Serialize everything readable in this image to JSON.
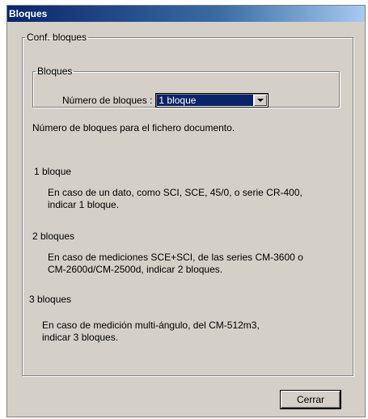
{
  "window": {
    "title": "Bloques"
  },
  "group": {
    "legend": "Conf. bloques",
    "inner_legend": "Bloques",
    "select_label": "Número de bloques :",
    "select_value": "1 bloque"
  },
  "description": "Número de bloques para el fichero documento.",
  "sections": [
    {
      "heading": "1 bloque",
      "line1": "En caso de un dato, como SCI, SCE, 45/0, o serie CR-400,",
      "line2": "indicar 1 bloque."
    },
    {
      "heading": "2 bloques",
      "line1": "En caso de mediciones SCE+SCI, de las series CM-3600 o",
      "line2": "CM-2600d/CM-2500d, indicar 2 bloques."
    },
    {
      "heading": "3 bloques",
      "line1": "En caso de medición multi-ángulo, del CM-512m3,",
      "line2": "indicar 3 bloques."
    }
  ],
  "buttons": {
    "close": "Cerrar"
  }
}
